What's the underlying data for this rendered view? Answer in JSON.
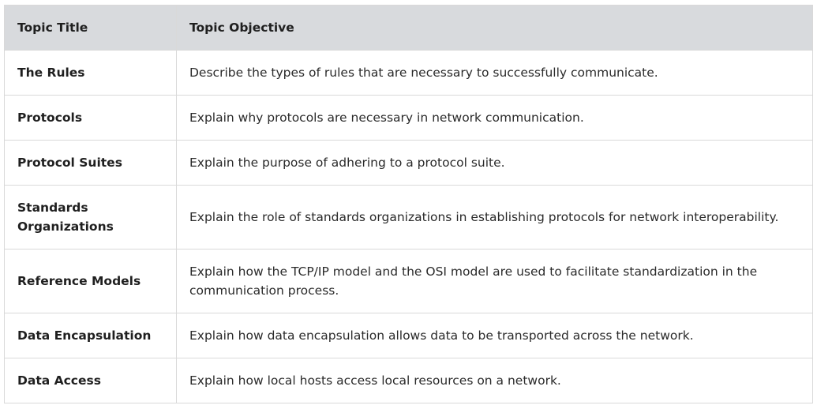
{
  "table": {
    "headers": [
      "Topic Title",
      "Topic Objective"
    ],
    "rows": [
      {
        "title": "The Rules",
        "objective": "Describe the types of rules that are necessary to successfully communicate."
      },
      {
        "title": "Protocols",
        "objective": "Explain why protocols are necessary in network communication."
      },
      {
        "title": "Protocol Suites",
        "objective": "Explain the purpose of adhering to a protocol suite."
      },
      {
        "title": "Standards Organizations",
        "objective": "Explain the role of standards organizations in establishing protocols for network interoperability."
      },
      {
        "title": "Reference Models",
        "objective": "Explain how the TCP/IP model and the OSI model are used to facilitate standardization in the communication process."
      },
      {
        "title": "Data Encapsulation",
        "objective": "Explain how data encapsulation allows data to be transported across the network."
      },
      {
        "title": "Data Access",
        "objective": "Explain how local hosts access local resources on a network."
      }
    ]
  },
  "colors": {
    "header_background": "#d8dadd",
    "border": "#d9d9d9",
    "text": "#1f1f1f"
  }
}
